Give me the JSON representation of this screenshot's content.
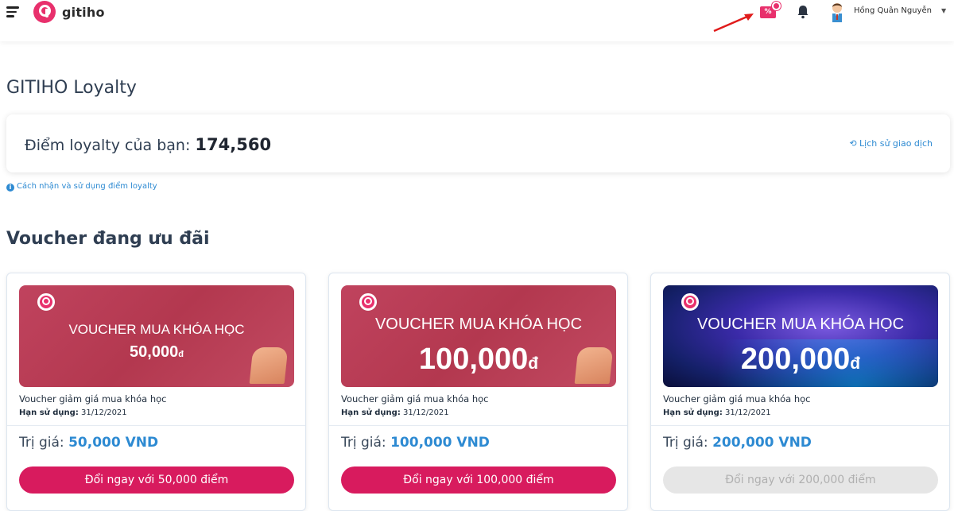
{
  "header": {
    "logo_text": "gitiho",
    "voucher_icon_text": "%",
    "user_name": "Hồng Quân Nguyễn"
  },
  "page": {
    "title": "GITIHO Loyalty",
    "points_label": "Điểm loyalty của bạn: ",
    "points_value": "174,560",
    "history_link": "Lịch sử giao dịch",
    "info_link": "Cách nhận và sử dụng điểm loyalty",
    "section_title": "Voucher đang ưu đãi"
  },
  "vouchers": [
    {
      "image_title": "VOUCHER MUA KHÓA HỌC",
      "image_amount": "50,000",
      "image_currency": "đ",
      "desc": "Voucher giảm giá mua khóa học",
      "expiry_label": "Hạn sử dụng:",
      "expiry_date": "31/12/2021",
      "value_label": "Trị giá: ",
      "value_amount": "50,000 VND",
      "button_label": "Đổi ngay với 50,000 điểm",
      "button_enabled": true
    },
    {
      "image_title": "VOUCHER MUA KHÓA HỌC",
      "image_amount": "100,000",
      "image_currency": "đ",
      "desc": "Voucher giảm giá mua khóa học",
      "expiry_label": "Hạn sử dụng:",
      "expiry_date": "31/12/2021",
      "value_label": "Trị giá: ",
      "value_amount": "100,000 VND",
      "button_label": "Đổi ngay với 100,000 điểm",
      "button_enabled": true
    },
    {
      "image_title": "VOUCHER MUA KHÓA HỌC",
      "image_amount": "200,000",
      "image_currency": "đ",
      "desc": "Voucher giảm giá mua khóa học",
      "expiry_label": "Hạn sử dụng:",
      "expiry_date": "31/12/2021",
      "value_label": "Trị giá: ",
      "value_amount": "200,000 VND",
      "button_label": "Đổi ngay với 200,000 điểm",
      "button_enabled": false
    }
  ],
  "colors": {
    "brand": "#e8306c",
    "button": "#d81b5e",
    "link": "#2d8ad2"
  }
}
